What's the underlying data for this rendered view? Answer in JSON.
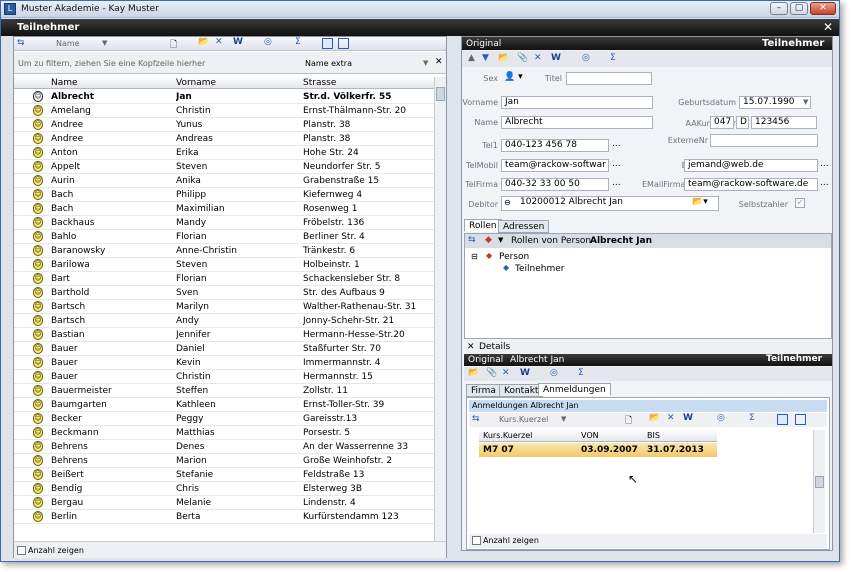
{
  "window": {
    "title": "Muster Akademie - Kay Muster"
  },
  "header": {
    "title": "Teilnehmer"
  },
  "left": {
    "filter_field": "Name",
    "group_hint": "Um zu filtern, ziehen Sie eine Kopfzeile hierher",
    "name_extra": "Name extra",
    "columns": [
      "Name",
      "Vorname",
      "Strasse"
    ],
    "rows": [
      [
        "Albrecht",
        "Jan",
        "Str.d. Völkerfr. 55"
      ],
      [
        "Amelang",
        "Christin",
        "Ernst-Thälmann-Str. 20"
      ],
      [
        "Andree",
        "Yunus",
        "Planstr. 38"
      ],
      [
        "Andree",
        "Andreas",
        "Planstr. 38"
      ],
      [
        "Anton",
        "Erika",
        "Hohe Str. 24"
      ],
      [
        "Appelt",
        "Steven",
        "Neundorfer Str. 5"
      ],
      [
        "Aurin",
        "Anika",
        "Grabenstraße 15"
      ],
      [
        "Bach",
        "Philipp",
        "Kiefernweg 4"
      ],
      [
        "Bach",
        "Maximilian",
        "Rosenweg 1"
      ],
      [
        "Backhaus",
        "Mandy",
        "Fröbelstr. 136"
      ],
      [
        "Bahlo",
        "Florian",
        "Berliner Str. 4"
      ],
      [
        "Baranowsky",
        "Anne-Christin",
        "Tränkestr. 6"
      ],
      [
        "Barilowa",
        "Steven",
        "Holbeinstr. 1"
      ],
      [
        "Bart",
        "Florian",
        "Schackensleber Str. 8"
      ],
      [
        "Barthold",
        "Sven",
        "Str. des Aufbaus 9"
      ],
      [
        "Bartsch",
        "Marilyn",
        "Walther-Rathenau-Str. 31"
      ],
      [
        "Bartsch",
        "Andy",
        "Jonny-Schehr-Str. 21"
      ],
      [
        "Bastian",
        "Jennifer",
        "Hermann-Hesse-Str.20"
      ],
      [
        "Bauer",
        "Daniel",
        "Staßfurter Str. 70"
      ],
      [
        "Bauer",
        "Kevin",
        "Immermannstr. 4"
      ],
      [
        "Bauer",
        "Christin",
        "Hermannstr. 15"
      ],
      [
        "Bauermeister",
        "Steffen",
        "Zollstr. 11"
      ],
      [
        "Baumgarten",
        "Kathleen",
        "Ernst-Toller-Str. 39"
      ],
      [
        "Becker",
        "Peggy",
        "Gareisstr.13"
      ],
      [
        "Beckmann",
        "Matthias",
        "Porsestr. 5"
      ],
      [
        "Behrens",
        "Denes",
        "An der Wasserrenne 33"
      ],
      [
        "Behrens",
        "Marion",
        "Große Weinhofstr. 2"
      ],
      [
        "Beißert",
        "Stefanie",
        "Feldstraße 13"
      ],
      [
        "Bendig",
        "Chris",
        "Elsterweg 3B"
      ],
      [
        "Bergau",
        "Melanie",
        "Lindenstr. 4"
      ],
      [
        "Berlin",
        "Berta",
        "Kurfürstendamm 123"
      ]
    ],
    "show_count": "Anzahl zeigen"
  },
  "right": {
    "header_left": "Original",
    "header_right": "Teilnehmer",
    "labels": {
      "sex": "Sex",
      "titel": "Titel",
      "vorname": "Vorname",
      "name": "Name",
      "tel1": "Tel1",
      "telmobil": "TelMobil",
      "telfirma": "TelFirma",
      "debitor": "Debitor",
      "geburtsdatum": "Geburtsdatum",
      "aakundennr": "AAKundenNr",
      "externenr": "ExterneNr",
      "email1": "EMail1",
      "emailfirma": "EMailFirma",
      "selbstzahler": "Selbstzahler"
    },
    "values": {
      "vorname": "Jan",
      "name": "Albrecht",
      "tel1": "040-123 456 78",
      "telmobil": "team@rackow-softwar",
      "telfirma": "040-32 33 00 50",
      "debitor": "10200012 Albrecht Jan",
      "geburtsdatum": "15.07.1990",
      "kunden_a": "047",
      "kunden_b": "D",
      "kunden_c": "123456",
      "email1": "jemand@web.de",
      "emailfirma": "team@rackow-software.de"
    },
    "tabs": [
      "Rollen",
      "Adressen"
    ],
    "rollen_title": "Rollen von Person",
    "rollen_person": "Albrecht Jan",
    "tree": {
      "person": "Person",
      "child": "Teilnehmer"
    },
    "details": {
      "label": "Details",
      "header_left": "Original",
      "header_name": "Albrecht Jan",
      "header_right": "Teilnehmer",
      "tabs": [
        "Firma",
        "Kontakt",
        "Anmeldungen"
      ],
      "group_title": "Anmeldungen Albrecht Jan",
      "filter_field": "Kurs.Kuerzel",
      "columns": [
        "Kurs.Kuerzel",
        "VON",
        "BIS"
      ],
      "row": [
        "M7 07",
        "03.09.2007",
        "31.07.2013"
      ],
      "show_count": "Anzahl zeigen"
    }
  }
}
